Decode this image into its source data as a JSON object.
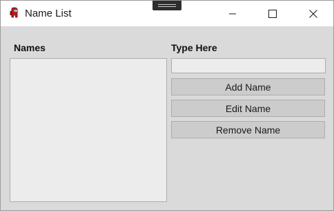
{
  "window": {
    "title": "Name List",
    "app_icon": "red-crewmate-icon",
    "controls": {
      "minimize_icon": "minimize-icon",
      "maximize_icon": "maximize-icon",
      "close_icon": "close-icon"
    }
  },
  "names_panel": {
    "label": "Names",
    "items": []
  },
  "input_panel": {
    "label": "Type Here",
    "value": "",
    "placeholder": ""
  },
  "buttons": {
    "add_label": "Add Name",
    "edit_label": "Edit Name",
    "remove_label": "Remove Name"
  },
  "colors": {
    "window_bg": "#dadada",
    "titlebar_bg": "#ffffff",
    "control_bg": "#ececec",
    "button_bg": "#cccccc",
    "border": "#adadad"
  }
}
